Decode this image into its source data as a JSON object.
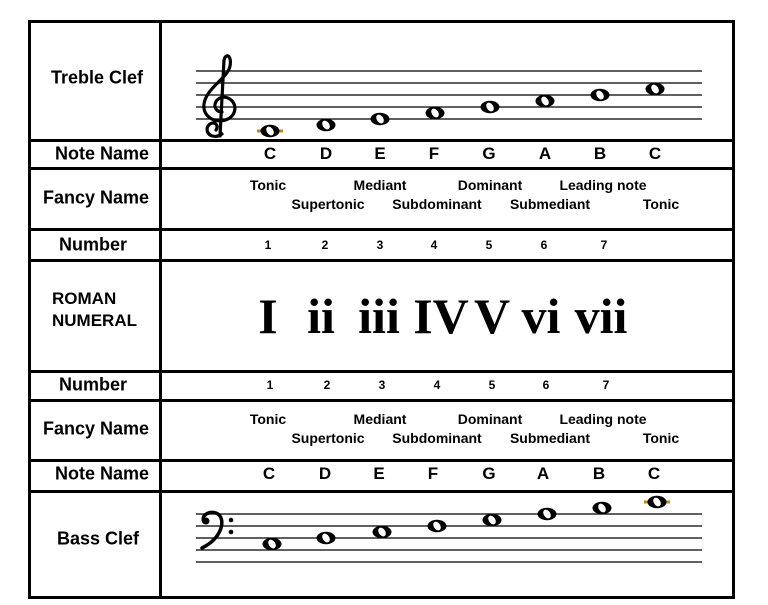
{
  "labels": {
    "treble_clef": "Treble Clef",
    "note_name": "Note Name",
    "fancy_name": "Fancy Name",
    "number": "Number",
    "roman_line1": "ROMAN",
    "roman_line2": "NUMERAL",
    "bass_clef": "Bass Clef"
  },
  "note_names": [
    "C",
    "D",
    "E",
    "F",
    "G",
    "A",
    "B",
    "C"
  ],
  "fancy_names_upper": [
    "Tonic",
    "Mediant",
    "Dominant",
    "Leading note"
  ],
  "fancy_names_lower": [
    "Supertonic",
    "Subdominant",
    "Submediant",
    "Tonic"
  ],
  "numbers": [
    "1",
    "2",
    "3",
    "4",
    "5",
    "6",
    "7"
  ],
  "roman_numerals": [
    "I",
    "ii",
    "iii",
    "IV",
    "V",
    "vi",
    "vii"
  ],
  "staff": {
    "treble_notes": [
      "C4",
      "D4",
      "E4",
      "F4",
      "G4",
      "A4",
      "B4",
      "C5"
    ],
    "bass_notes": [
      "C3",
      "D3",
      "E3",
      "F3",
      "G3",
      "A3",
      "B3",
      "C4"
    ],
    "ledger_color": "#c8860b",
    "icons": {
      "treble": "treble-clef-icon",
      "bass": "bass-clef-icon",
      "note": "whole-note-icon"
    }
  }
}
